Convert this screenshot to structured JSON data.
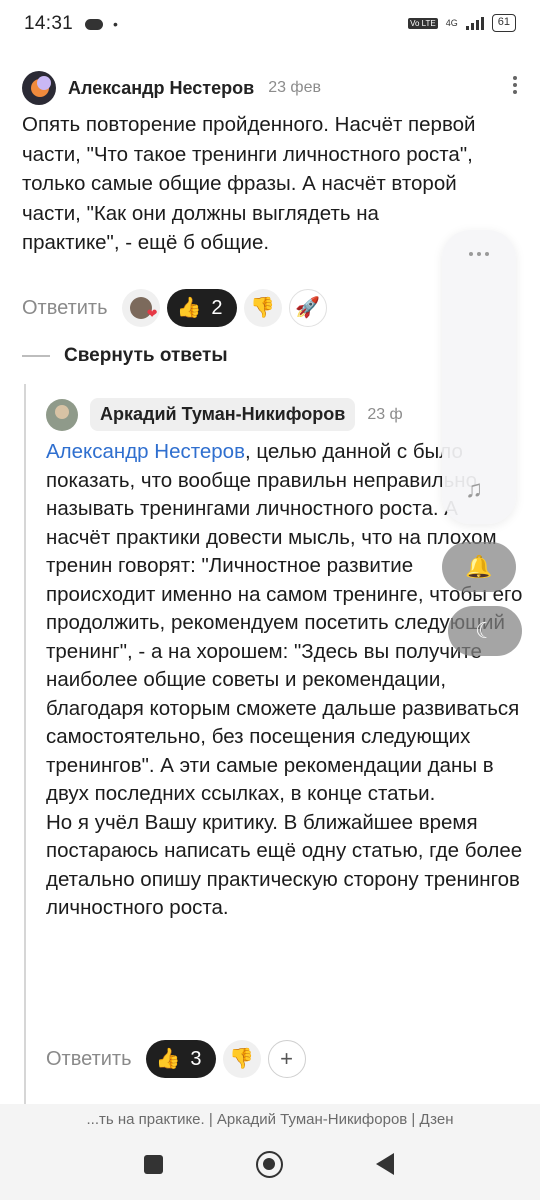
{
  "status_bar": {
    "time": "14:31",
    "network": "4G",
    "volte": "Vo LTE",
    "battery": "61"
  },
  "comment": {
    "author": "Александр Нестеров",
    "date": "23 фев",
    "text": "Опять повторение пройденного. Насчёт первой части, \"Что такое тренинги личностного роста\", только самые общие фразы. А насчёт второй части, \"Как они должны выглядеть на практике\", - ещё б общие.",
    "reply_label": "Ответить",
    "reactions": {
      "like_count": "2"
    }
  },
  "collapse_replies_label": "Свернуть ответы",
  "reply": {
    "author": "Аркадий Туман-Никифоров",
    "date": "23 ф",
    "mention": "Александр Нестеров",
    "text_after_mention": ", целью данной с было показать, что вообще правильн неправильно называть тренингами личностного роста. А насчёт практики довести мысль, что на плохом тренин говорят: \"Личностное развитие происходит именно на самом тренинге, чтобы его продолжить, рекомендуем посетить следующий тренинг\", - а на хорошем: \"Здесь вы получите наиболее общие советы и рекомендации, благодаря которым сможете дальше развиваться самостоятельно, без посещения следующих тренингов\". А эти самые рекомендации даны в двух последних ссылках, в конце статьи.",
    "text_second_paragraph": "Но я учёл Вашу критику. В ближайшее время постараюсь написать ещё одну статью, где более детально опишу практическую сторону тренингов личностного роста.",
    "reply_label": "Ответить",
    "reactions": {
      "like_count": "3"
    }
  },
  "page_caption": "...ть на практике. | Аркадий Туман-Никифоров | Дзен",
  "icons": {
    "like": "👍",
    "dislike": "👎",
    "rocket": "🚀",
    "heart": "❤",
    "music": "♫",
    "bell": "🔔",
    "moon": "☾",
    "plus": "+"
  },
  "colors": {
    "mention": "#2f6fcf",
    "dark_pill": "#1f1f1f"
  }
}
